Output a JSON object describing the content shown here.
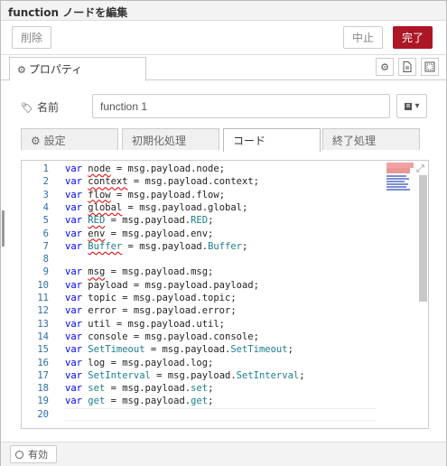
{
  "tray": {
    "title": "function ノードを編集",
    "delete_label": "削除",
    "cancel_label": "中止",
    "done_label": "完了"
  },
  "tabs": {
    "properties_label": "プロパティ"
  },
  "name_field": {
    "label": "名前",
    "value": "function 1"
  },
  "subtabs": [
    "設定",
    "初期化処理",
    "コード",
    "終了処理"
  ],
  "active_subtab": "コード",
  "code_lines": [
    {
      "n": "1",
      "tokens": [
        [
          "kw",
          "var"
        ],
        [
          "t",
          " "
        ],
        [
          "sq",
          "node"
        ],
        [
          "t",
          " = msg.payload.node;"
        ]
      ]
    },
    {
      "n": "2",
      "tokens": [
        [
          "kw",
          "var"
        ],
        [
          "t",
          " "
        ],
        [
          "sq",
          "context"
        ],
        [
          "t",
          " = msg.payload.context;"
        ]
      ]
    },
    {
      "n": "3",
      "tokens": [
        [
          "kw",
          "var"
        ],
        [
          "t",
          " "
        ],
        [
          "sq",
          "flow"
        ],
        [
          "t",
          " = msg.payload.flow;"
        ]
      ]
    },
    {
      "n": "4",
      "tokens": [
        [
          "kw",
          "var"
        ],
        [
          "t",
          " "
        ],
        [
          "sq",
          "global"
        ],
        [
          "t",
          " = msg.payload.global;"
        ]
      ]
    },
    {
      "n": "5",
      "tokens": [
        [
          "kw",
          "var"
        ],
        [
          "t",
          " "
        ],
        [
          "sqp",
          "RED"
        ],
        [
          "t",
          " = msg.payload."
        ],
        [
          "pr",
          "RED"
        ],
        [
          "t",
          ";"
        ]
      ]
    },
    {
      "n": "6",
      "tokens": [
        [
          "kw",
          "var"
        ],
        [
          "t",
          " "
        ],
        [
          "sq",
          "env"
        ],
        [
          "t",
          " = msg.payload.env;"
        ]
      ]
    },
    {
      "n": "7",
      "tokens": [
        [
          "kw",
          "var"
        ],
        [
          "t",
          " "
        ],
        [
          "sqp",
          "Buffer"
        ],
        [
          "t",
          " = msg.payload."
        ],
        [
          "pr",
          "Buffer"
        ],
        [
          "t",
          ";"
        ]
      ]
    },
    {
      "n": "8",
      "tokens": []
    },
    {
      "n": "9",
      "tokens": [
        [
          "kw",
          "var"
        ],
        [
          "t",
          " "
        ],
        [
          "sq",
          "msg"
        ],
        [
          "t",
          " = msg.payload.msg;"
        ]
      ]
    },
    {
      "n": "10",
      "tokens": [
        [
          "kw",
          "var"
        ],
        [
          "t",
          " payload = msg.payload.payload;"
        ]
      ]
    },
    {
      "n": "11",
      "tokens": [
        [
          "kw",
          "var"
        ],
        [
          "t",
          " topic = msg.payload.topic;"
        ]
      ]
    },
    {
      "n": "12",
      "tokens": [
        [
          "kw",
          "var"
        ],
        [
          "t",
          " error = msg.payload.error;"
        ]
      ]
    },
    {
      "n": "13",
      "tokens": [
        [
          "kw",
          "var"
        ],
        [
          "t",
          " util = msg.payload.util;"
        ]
      ]
    },
    {
      "n": "14",
      "tokens": [
        [
          "kw",
          "var"
        ],
        [
          "t",
          " console = msg.payload.console;"
        ]
      ]
    },
    {
      "n": "15",
      "tokens": [
        [
          "kw",
          "var"
        ],
        [
          "t",
          " "
        ],
        [
          "pr",
          "SetTimeout"
        ],
        [
          "t",
          " = msg.payload."
        ],
        [
          "pr",
          "SetTimeout"
        ],
        [
          "t",
          ";"
        ]
      ]
    },
    {
      "n": "16",
      "tokens": [
        [
          "kw",
          "var"
        ],
        [
          "t",
          " log = msg.payload.log;"
        ]
      ]
    },
    {
      "n": "17",
      "tokens": [
        [
          "kw",
          "var"
        ],
        [
          "t",
          " "
        ],
        [
          "pr",
          "SetInterval"
        ],
        [
          "t",
          " = msg.payload."
        ],
        [
          "pr",
          "SetInterval"
        ],
        [
          "t",
          ";"
        ]
      ]
    },
    {
      "n": "18",
      "tokens": [
        [
          "kw",
          "var"
        ],
        [
          "t",
          " "
        ],
        [
          "pr",
          "set"
        ],
        [
          "t",
          " = msg.payload."
        ],
        [
          "pr",
          "set"
        ],
        [
          "t",
          ";"
        ]
      ]
    },
    {
      "n": "19",
      "tokens": [
        [
          "kw",
          "var"
        ],
        [
          "t",
          " "
        ],
        [
          "pr",
          "get"
        ],
        [
          "t",
          " = msg.payload."
        ],
        [
          "pr",
          "get"
        ],
        [
          "t",
          ";"
        ]
      ]
    },
    {
      "n": "20",
      "tokens": []
    }
  ],
  "footer": {
    "enable_label": "有効"
  },
  "colors": {
    "done_button": "#ad1625",
    "keyword": "#0000ff",
    "property": "#1a7f8a",
    "line_number": "#2e6ea5"
  }
}
